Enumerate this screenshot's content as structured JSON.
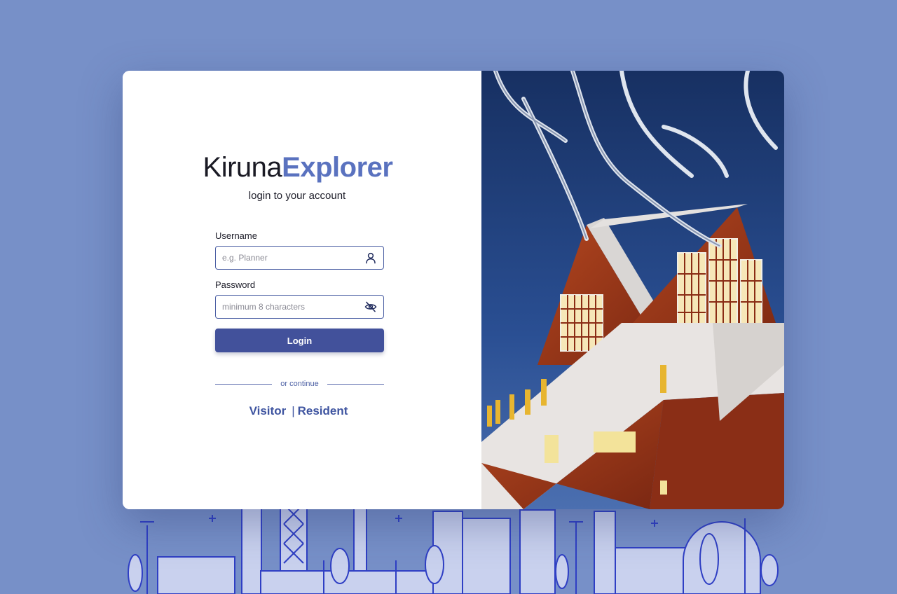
{
  "brand": {
    "part1": "Kiruna",
    "part2": "Explorer"
  },
  "subtitle": "login to your account",
  "username": {
    "label": "Username",
    "placeholder": "e.g. Planner",
    "icon": "user-icon"
  },
  "password": {
    "label": "Password",
    "placeholder": "minimum 8 characters",
    "icon": "eye-off-icon"
  },
  "login_button": "Login",
  "divider_text": "or continue",
  "alt_login": {
    "visitor": "Visitor",
    "separator": "|",
    "resident": "Resident"
  },
  "colors": {
    "background": "#7790c8",
    "accent": "#42519b",
    "brand_blue": "#5a72bf",
    "skyline_stroke": "#2f3fc4"
  }
}
